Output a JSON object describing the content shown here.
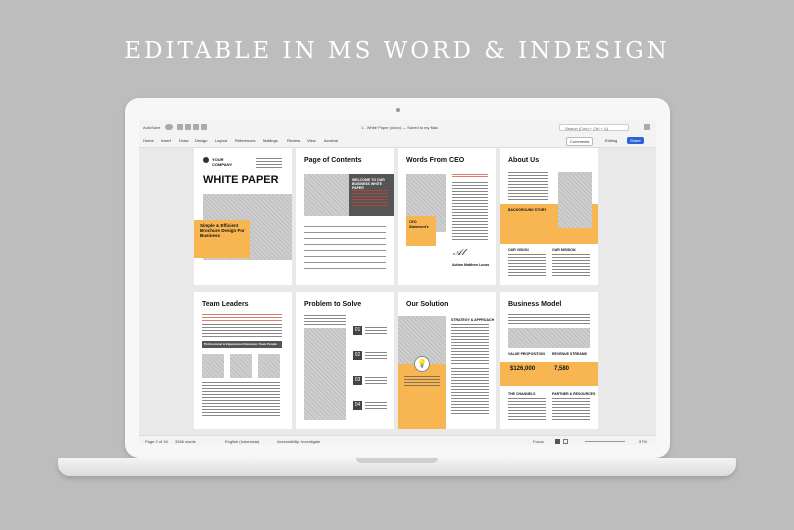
{
  "headline": "EDITABLE IN MS WORD & INDESIGN",
  "window": {
    "autosave_label": "AutoSave",
    "doc_title": "1 - White Paper (docx) — Saved to my Mac",
    "search_placeholder": "Search (Cmd + Ctrl + U)"
  },
  "ribbon": {
    "tabs": [
      "Home",
      "Insert",
      "Draw",
      "Design",
      "Layout",
      "References",
      "Mailings",
      "Review",
      "View",
      "Acrobat"
    ],
    "comments_label": "Comments",
    "editing_label": "Editing",
    "share_label": "Share"
  },
  "pages": {
    "p1": {
      "company": "YOUR COMPANY",
      "title": "WHITE PAPER",
      "box_text": "Simple & Efficient Brochure Design For Business"
    },
    "p2": {
      "title": "Page of Contents",
      "box_text": "WELCOME TO OUR BUSINESS WHITE PAPER"
    },
    "p3": {
      "title": "Words From CEO",
      "box_text": "CEO Statement's",
      "signer": "Adrian Matthew Lucas"
    },
    "p4": {
      "title": "About Us",
      "box_text": "BACKGROUND STORY",
      "col1": "OUR VISION",
      "col2": "OUR MISSION"
    },
    "p5": {
      "title": "Team Leaders",
      "bar_text": "Professional & Experienced Business Team People"
    },
    "p6": {
      "title": "Problem to Solve",
      "nums": [
        "01",
        "02",
        "03",
        "04"
      ]
    },
    "p7": {
      "title": "Our Solution",
      "label": "STRATEGY & APPROACH"
    },
    "p8": {
      "title": "Business Model",
      "stat1": "$126,000",
      "stat2": "7,580",
      "label1": "VALUE PROPOSITION",
      "label2": "REVENUE STREAMS",
      "label3": "THE CHANNELS",
      "label4": "PARTNER & RESOURCES"
    }
  },
  "status": {
    "page": "Page 2 of 16",
    "words": "3346 words",
    "language": "English (Indonesia)",
    "accessibility": "Accessibility: Investigate",
    "focus": "Focus",
    "zoom": "97%"
  }
}
